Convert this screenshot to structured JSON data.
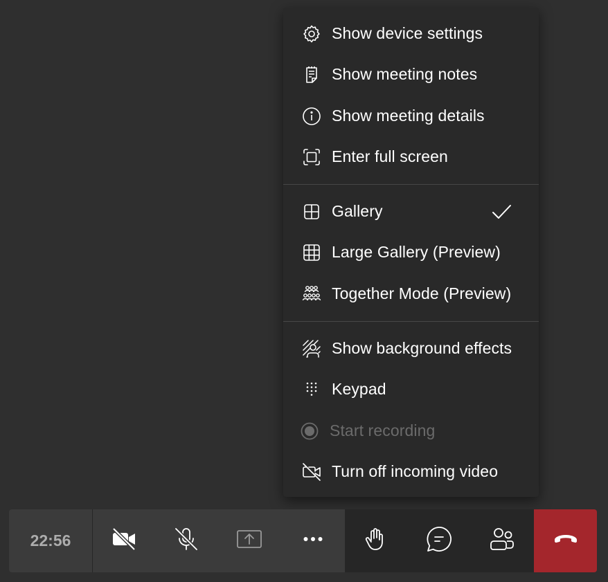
{
  "menu": {
    "items": [
      {
        "label": "Show device settings",
        "icon": "gear-icon"
      },
      {
        "label": "Show meeting notes",
        "icon": "notes-icon"
      },
      {
        "label": "Show meeting details",
        "icon": "info-icon"
      },
      {
        "label": "Enter full screen",
        "icon": "fullscreen-icon"
      },
      {
        "label": "Gallery",
        "icon": "gallery-icon",
        "checked": true
      },
      {
        "label": "Large Gallery (Preview)",
        "icon": "large-gallery-icon"
      },
      {
        "label": "Together Mode (Preview)",
        "icon": "together-mode-icon"
      },
      {
        "label": "Show background effects",
        "icon": "background-effects-icon"
      },
      {
        "label": "Keypad",
        "icon": "keypad-icon"
      },
      {
        "label": "Start recording",
        "icon": "record-icon",
        "disabled": true
      },
      {
        "label": "Turn off incoming video",
        "icon": "video-off-icon"
      }
    ]
  },
  "toolbar": {
    "timer": "22:56",
    "buttons": [
      {
        "name": "camera-toggle",
        "icon": "camera-off-icon"
      },
      {
        "name": "mic-toggle",
        "icon": "mic-off-icon"
      },
      {
        "name": "share-screen",
        "icon": "share-tray-icon"
      },
      {
        "name": "more-actions",
        "icon": "ellipsis-icon"
      },
      {
        "name": "raise-hand",
        "icon": "hand-icon"
      },
      {
        "name": "chat",
        "icon": "chat-icon"
      },
      {
        "name": "participants",
        "icon": "people-icon"
      },
      {
        "name": "leave-call",
        "icon": "hang-up-icon"
      }
    ]
  },
  "colors": {
    "background": "#2f2f2f",
    "menu": "#292929",
    "toolbar_left": "#3b3b3b",
    "toolbar_right": "#262626",
    "leave": "#a4262c",
    "disabled_text": "#6b6b6b"
  }
}
